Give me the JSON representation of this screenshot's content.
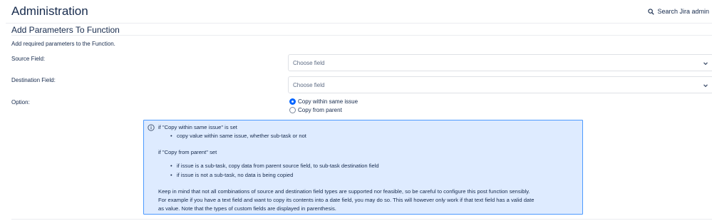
{
  "header": {
    "title": "Administration",
    "search_label": "Search Jira admin"
  },
  "section": {
    "title": "Add Parameters To Function",
    "description": "Add required parameters to the Function."
  },
  "fields": {
    "source": {
      "label": "Source Field:",
      "placeholder": "Choose field"
    },
    "destination": {
      "label": "Destination Field:",
      "placeholder": "Choose field"
    },
    "option": {
      "label": "Option:",
      "choices": [
        {
          "label": "Copy within same issue",
          "selected": true
        },
        {
          "label": "Copy from parent",
          "selected": false
        }
      ]
    }
  },
  "info": {
    "line1": "if \"Copy within same issue\" is set",
    "line1_bullets": [
      "copy value within same issue, whether sub-task or not"
    ],
    "line2": "if \"Copy from parent\" set",
    "line2_bullets": [
      "if issue is a sub-task, copy data from parent source field, to sub-task destination field",
      "if issue is not a sub-task, no data is being copied"
    ],
    "note_lines": [
      "Keep in mind that not all combinations of source and destination field types are supported nor feasible, so be careful to configure this post function sensibly.",
      "For example if you have a text field and want to copy its contents into a date field, you may do so. This will however only work if that text field has a valid date",
      "as value. Note that the types of custom fields are displayed in parenthesis."
    ]
  },
  "colors": {
    "text": "#172b4d",
    "info_border": "#4c9aff",
    "info_background": "#deebff",
    "radio_selected": "#0065ff"
  }
}
